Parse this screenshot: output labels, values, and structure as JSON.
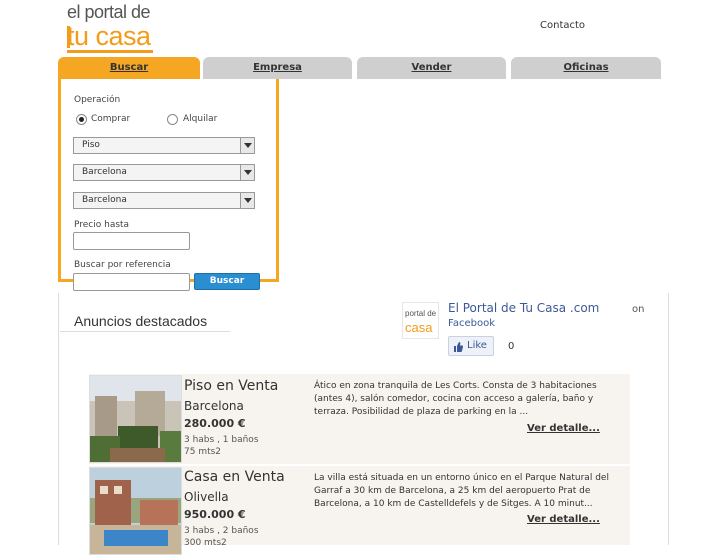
{
  "logo": {
    "line1": "el portal de",
    "line2": "tu casa"
  },
  "header": {
    "contact_label": "Contacto"
  },
  "tabs": [
    {
      "label": "Buscar",
      "active": true
    },
    {
      "label": "Empresa",
      "active": false
    },
    {
      "label": "Vender",
      "active": false
    },
    {
      "label": "Oficinas",
      "active": false
    }
  ],
  "search": {
    "operation_label": "Operación",
    "option_buy": "Comprar",
    "option_rent": "Alquilar",
    "selected_operation": "Comprar",
    "type_value": "Piso",
    "province_value": "Barcelona",
    "city_value": "Barcelona",
    "price_label": "Precio hasta",
    "price_value": "",
    "reference_label": "Buscar por referencia",
    "reference_value": "",
    "search_button": "Buscar"
  },
  "featured": {
    "title": "Anuncios destacados"
  },
  "facebook": {
    "logo_text_1": "portal de",
    "logo_text_2": "casa",
    "page_name": "El Portal de Tu Casa .com",
    "on_label": "on",
    "facebook_label": "Facebook",
    "like_label": "Like",
    "like_count": "0"
  },
  "listings": [
    {
      "title": "Piso en Venta",
      "city": "Barcelona",
      "price": "280.000 €",
      "rooms": "3 habs , 1 baños",
      "area": "75 mts2",
      "description": "Ático en zona tranquila de Les Corts. Consta de 3 habitaciones (antes 4), salón comedor, cocina con acceso a galería, baño y terraza. Posibilidad de plaza de parking en la ...",
      "more_label": "Ver detalle..."
    },
    {
      "title": "Casa en Venta",
      "city": "Olivella",
      "price": "950.000 €",
      "rooms": "3 habs , 2 baños",
      "area": "300 mts2",
      "description": "La villa está situada en un entorno único en el Parque Natural del Garraf a 30 km de Barcelona, a 25 km del aeropuerto Prat de Barcelona, a 10 km de Castelldefels y de Sitges. A 10 minut...",
      "more_label": "Ver detalle..."
    }
  ],
  "colors": {
    "accent": "#f5a623",
    "tab_inactive": "#cfcfcf",
    "button": "#2a8ed1",
    "facebook": "#3b5998"
  }
}
